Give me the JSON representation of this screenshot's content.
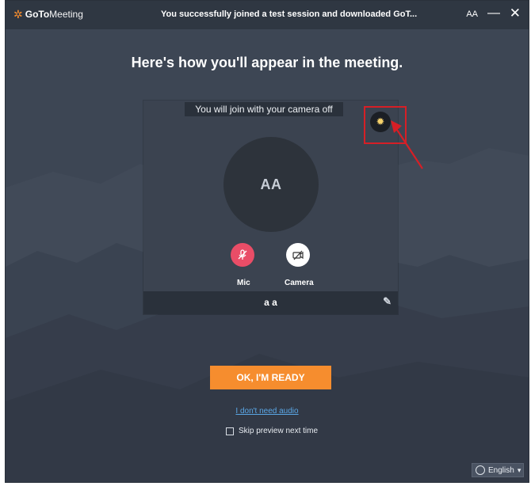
{
  "app": {
    "logo_bold": "GoTo",
    "logo_light": "Meeting",
    "title": "You successfully joined a test session and downloaded GoT...",
    "initials": "AA",
    "minimize_glyph": "—",
    "close_glyph": "✕"
  },
  "heading": "Here's how you'll appear in the meeting.",
  "preview": {
    "notice": "You will join with your camera off",
    "avatar_initials": "AA",
    "mic_label": "Mic",
    "camera_label": "Camera",
    "display_name": "a a"
  },
  "actions": {
    "ok_label": "OK, I'M READY",
    "no_audio_link": "I don't need audio",
    "skip_preview_label": "Skip preview next time"
  },
  "language": {
    "selected": "English"
  },
  "icons": {
    "gear": "gear-icon",
    "mic_muted": "mic-muted-icon",
    "camera_off": "camera-off-icon",
    "pencil": "edit-pencil-icon",
    "globe": "globe-icon"
  },
  "colors": {
    "accent_orange": "#f68d2e",
    "mic_pink": "#e94d67",
    "highlight_red": "#d61f26",
    "link_blue": "#5aa7e6"
  }
}
